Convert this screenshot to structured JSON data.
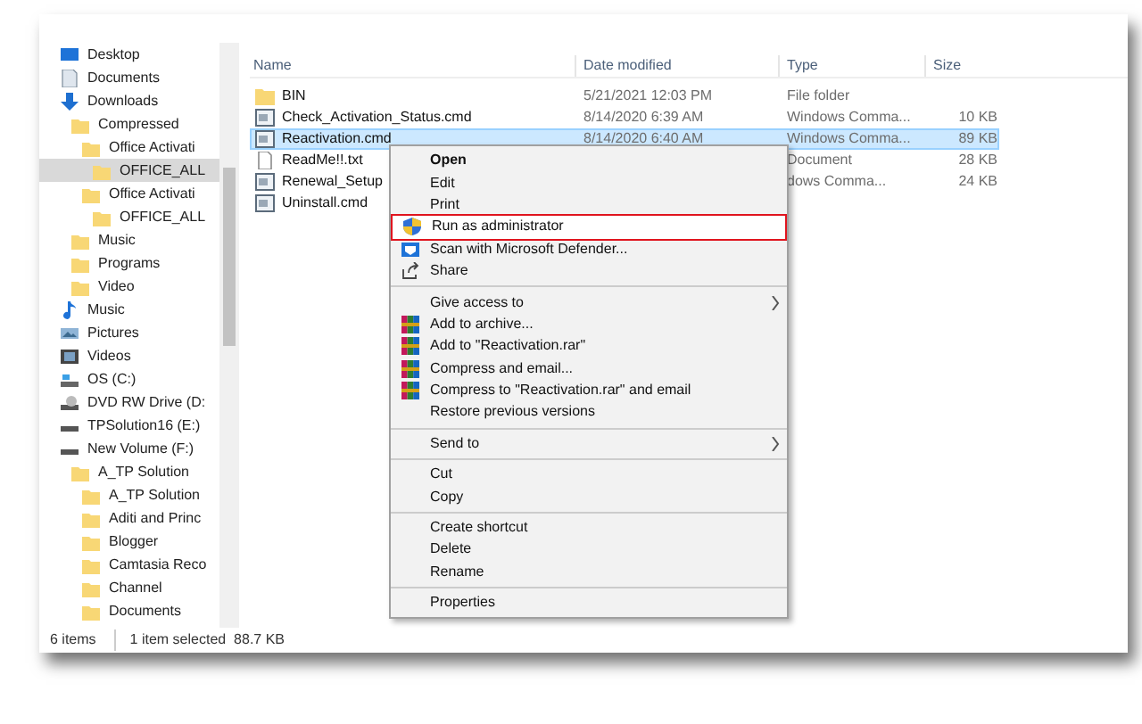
{
  "sidebar": {
    "items": [
      {
        "label": "Desktop",
        "kind": "desktop",
        "selected": false
      },
      {
        "label": "Documents",
        "kind": "documents",
        "selected": false
      },
      {
        "label": "Downloads",
        "kind": "downloads",
        "selected": false,
        "children": [
          {
            "label": "Compressed",
            "kind": "folder",
            "selected": false,
            "children": [
              {
                "label": "Office Activati",
                "kind": "folder",
                "selected": false,
                "children": [
                  {
                    "label": "OFFICE_ALL",
                    "kind": "folder",
                    "selected": true
                  }
                ]
              },
              {
                "label": "Office Activati",
                "kind": "folder",
                "selected": false,
                "children": [
                  {
                    "label": "OFFICE_ALL",
                    "kind": "folder",
                    "selected": false
                  }
                ]
              }
            ]
          },
          {
            "label": "Music",
            "kind": "folder",
            "selected": false
          },
          {
            "label": "Programs",
            "kind": "folder",
            "selected": false
          },
          {
            "label": "Video",
            "kind": "folder",
            "selected": false
          }
        ]
      },
      {
        "label": "Music",
        "kind": "music",
        "selected": false
      },
      {
        "label": "Pictures",
        "kind": "pictures",
        "selected": false
      },
      {
        "label": "Videos",
        "kind": "videos",
        "selected": false
      },
      {
        "label": "OS (C:)",
        "kind": "os",
        "selected": false
      },
      {
        "label": "DVD RW Drive (D:",
        "kind": "dvd",
        "selected": false
      },
      {
        "label": "TPSolution16 (E:)",
        "kind": "drive",
        "selected": false
      },
      {
        "label": "New Volume (F:)",
        "kind": "drive",
        "selected": false,
        "children": [
          {
            "label": "A_TP Solution",
            "kind": "folder",
            "selected": false,
            "children": [
              {
                "label": "A_TP Solution",
                "kind": "folder",
                "selected": false
              },
              {
                "label": "Aditi and Princ",
                "kind": "folder",
                "selected": false
              },
              {
                "label": "Blogger",
                "kind": "folder",
                "selected": false
              },
              {
                "label": "Camtasia Reco",
                "kind": "folder",
                "selected": false
              },
              {
                "label": "Channel",
                "kind": "folder",
                "selected": false
              },
              {
                "label": "Documents",
                "kind": "folder",
                "selected": false
              }
            ]
          }
        ]
      }
    ]
  },
  "file_list": {
    "columns": [
      "Name",
      "Date modified",
      "Type",
      "Size"
    ],
    "rows": [
      {
        "kind": "folder",
        "name": "BIN",
        "date": "5/21/2021 12:03 PM",
        "type": "File folder",
        "selected": false
      },
      {
        "kind": "cmd",
        "name": "Check_Activation_Status.cmd",
        "date": "8/14/2020 6:39 AM",
        "type": "Windows Comma...",
        "size": "10 KB",
        "selected": false
      },
      {
        "kind": "cmd",
        "name": "Reactivation.cmd",
        "date": "8/14/2020 6:40 AM",
        "type": "Windows Comma...",
        "size": "89 KB",
        "selected": true
      },
      {
        "kind": "txt",
        "name": "ReadMe!!.txt",
        "type": "Document",
        "size": "28 KB",
        "selected": false
      },
      {
        "kind": "cmd",
        "name": "Renewal_Setup",
        "type": "dows Comma...",
        "size": "24 KB",
        "selected": false
      },
      {
        "kind": "cmd",
        "name": "Uninstall.cmd",
        "selected": false
      }
    ]
  },
  "context_menu": {
    "groups": [
      [
        {
          "label": "Open",
          "bold": true
        },
        {
          "label": "Edit"
        },
        {
          "label": "Print"
        },
        {
          "label": "Run as administrator",
          "kind": "shield",
          "outlined": true
        },
        {
          "label": "Scan with Microsoft Defender...",
          "kind": "defender"
        },
        {
          "label": "Share",
          "kind": "share"
        }
      ],
      [
        {
          "label": "Give access to",
          "submenu": true
        },
        {
          "label": "Add to archive...",
          "kind": "archive"
        },
        {
          "label": "Add to \"Reactivation.rar\"",
          "kind": "archive"
        },
        {
          "label": "Compress and email...",
          "kind": "archive"
        },
        {
          "label": "Compress to \"Reactivation.rar\" and email",
          "kind": "archive"
        },
        {
          "label": "Restore previous versions"
        }
      ],
      [
        {
          "label": "Send to",
          "submenu": true
        }
      ],
      [
        {
          "label": "Cut"
        },
        {
          "label": "Copy"
        }
      ],
      [
        {
          "label": "Create shortcut"
        },
        {
          "label": "Delete"
        },
        {
          "label": "Rename"
        }
      ],
      [
        {
          "label": "Properties"
        }
      ]
    ]
  },
  "status_bar": {
    "item_count": "6 items",
    "selection": "1 item selected  88.7 KB"
  }
}
